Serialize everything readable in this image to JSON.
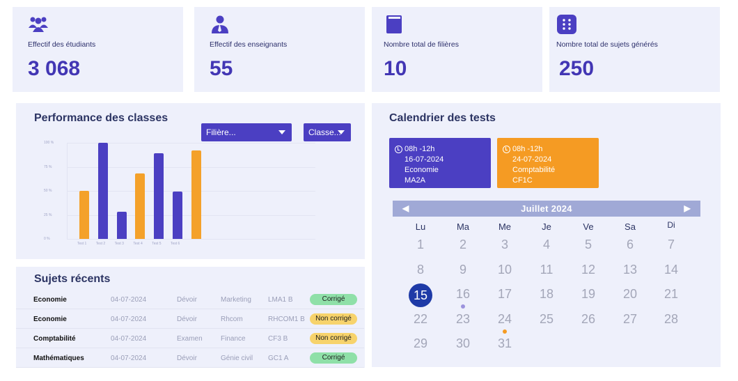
{
  "stats": [
    {
      "label": "Effectif des étudiants",
      "value": "3 068",
      "icon": "users-group-icon"
    },
    {
      "label": "Effectif des enseignants",
      "value": "55",
      "icon": "teacher-icon"
    },
    {
      "label": "Nombre total de filières",
      "value": "10",
      "icon": "book-icon"
    },
    {
      "label": "Nombre total de sujets générés",
      "value": "250",
      "icon": "grid-dots-icon"
    }
  ],
  "performance": {
    "title": "Performance des classes",
    "filiere_label": "Filière...",
    "classe_label": "Classe..."
  },
  "chart_data": {
    "type": "bar",
    "title": "",
    "categories": [
      "Test 1",
      "Test 2",
      "Test 3",
      "Test 4",
      "Test 5",
      "Test 6",
      "Test 7"
    ],
    "values": [
      50,
      100,
      28,
      68,
      89,
      49,
      92
    ],
    "bar_colors": [
      "#f4a12a",
      "#4b3fc2",
      "#4b3fc2",
      "#f4a12a",
      "#4b3fc2",
      "#4b3fc2",
      "#f4a12a"
    ],
    "y_ticks": [
      "100 %",
      "75 %",
      "50 %",
      "25 %",
      "0 %"
    ],
    "x_tick_labels": [
      "Test 1",
      "Test 2",
      "Test 3",
      "Test 4",
      "Test 5",
      "Test 6",
      ""
    ],
    "ylim": [
      0,
      100
    ],
    "grid": true
  },
  "recent": {
    "title": "Sujets récents",
    "rows": [
      {
        "subject": "Economie",
        "date": "04-07-2024",
        "type": "Dévoir",
        "field": "Marketing",
        "class": "LMA1 B",
        "status": "Corrigé",
        "status_color": "#8fe0a8"
      },
      {
        "subject": "Economie",
        "date": "04-07-2024",
        "type": "Dévoir",
        "field": "Rhcom",
        "class": "RHCOM1 B",
        "status": "Non corrigé",
        "status_color": "#f7d36c"
      },
      {
        "subject": "Comptabilité",
        "date": "04-07-2024",
        "type": "Examen",
        "field": "Finance",
        "class": "CF3 B",
        "status": "Non corrigé",
        "status_color": "#f7d36c"
      },
      {
        "subject": "Mathématiques",
        "date": "04-07-2024",
        "type": "Dévoir",
        "field": "Génie civil",
        "class": "GC1 A",
        "status": "Corrigé",
        "status_color": "#8fe0a8"
      }
    ]
  },
  "calendar": {
    "title": "Calendrier des tests",
    "events": [
      {
        "time": "08h -12h",
        "date": "16-07-2024",
        "subject": "Economie",
        "class": "MA2A",
        "color": "#4b3fc2"
      },
      {
        "time": "08h -12h",
        "date": "24-07-2024",
        "subject": "Comptabilité",
        "class": "CF1C",
        "color": "#f59b23"
      }
    ],
    "month": "Juillet 2024",
    "prev": "◀",
    "next": "▶",
    "weekdays": [
      "Lu",
      "Ma",
      "Me",
      "Je",
      "Ve",
      "Sa",
      "Di"
    ],
    "days": [
      "1",
      "2",
      "3",
      "4",
      "5",
      "6",
      "7",
      "8",
      "9",
      "10",
      "11",
      "12",
      "13",
      "14",
      "15",
      "16",
      "17",
      "18",
      "19",
      "20",
      "21",
      "22",
      "23",
      "24",
      "25",
      "26",
      "27",
      "28",
      "29",
      "30",
      "31"
    ],
    "selected_day": "15",
    "marked": [
      {
        "day": "16",
        "color": "#9c93dd"
      },
      {
        "day": "24",
        "color": "#f59b23"
      }
    ]
  }
}
